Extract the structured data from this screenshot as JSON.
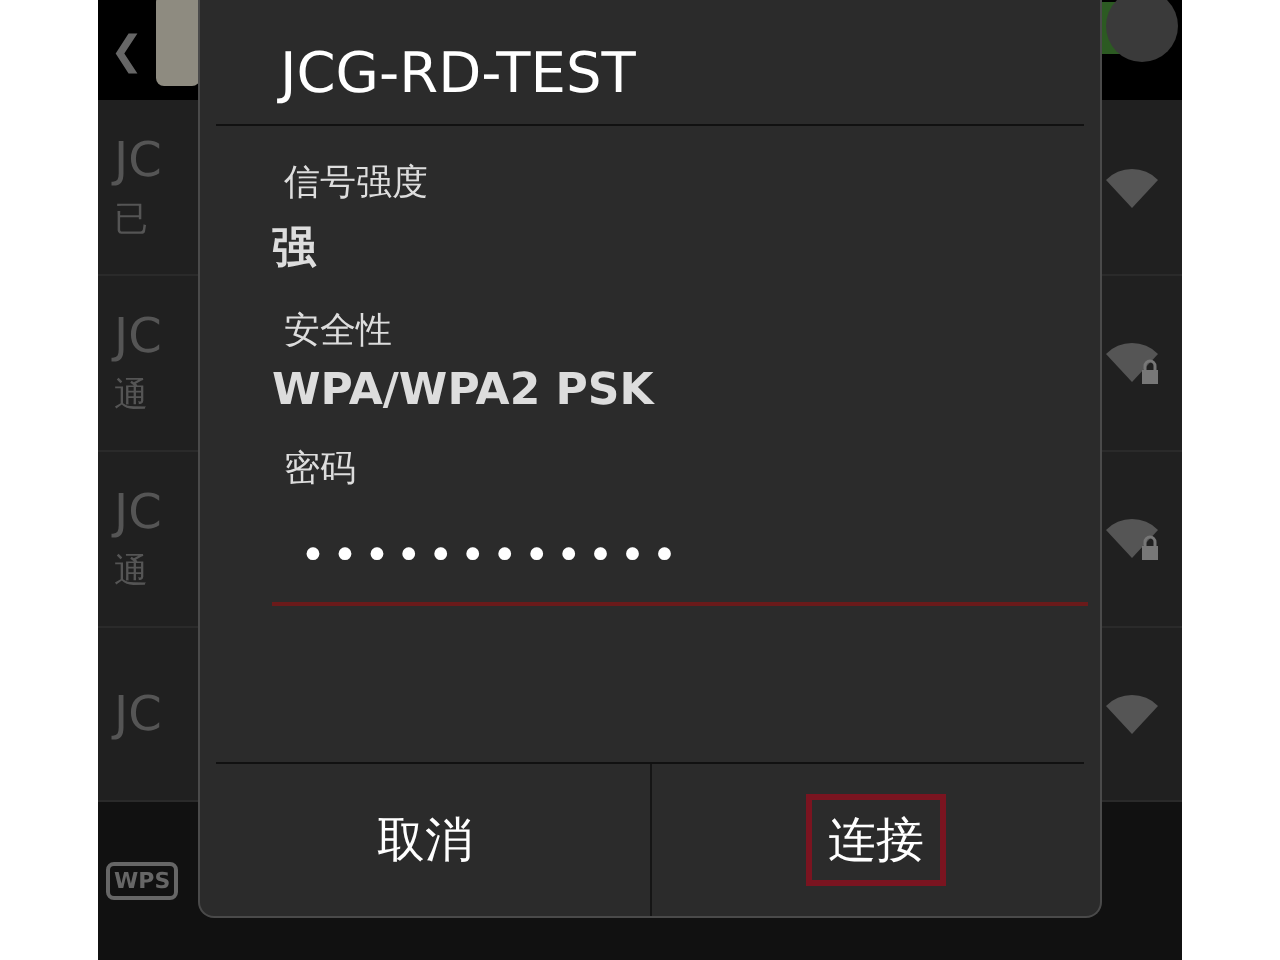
{
  "header": {
    "back": "❮",
    "wifi_switch": {
      "on": true
    }
  },
  "networks": [
    {
      "name": "JC",
      "status": "已",
      "locked": false
    },
    {
      "name": "JC",
      "status": "通",
      "locked": true
    },
    {
      "name": "JC",
      "status": "通",
      "locked": true
    },
    {
      "name": "JC",
      "locked": false
    }
  ],
  "bottom_bar": {
    "wps": "WPS"
  },
  "dialog": {
    "title": "JCG-RD-TEST",
    "fields": [
      {
        "label": "信号强度",
        "value": "强"
      },
      {
        "label": "安全性",
        "value": "WPA/WPA2 PSK"
      }
    ],
    "password": {
      "label": "密码",
      "value": "••••••••••••"
    },
    "buttons": [
      {
        "label": "取消",
        "highlighted": false
      },
      {
        "label": "连接",
        "highlighted": true
      }
    ]
  }
}
